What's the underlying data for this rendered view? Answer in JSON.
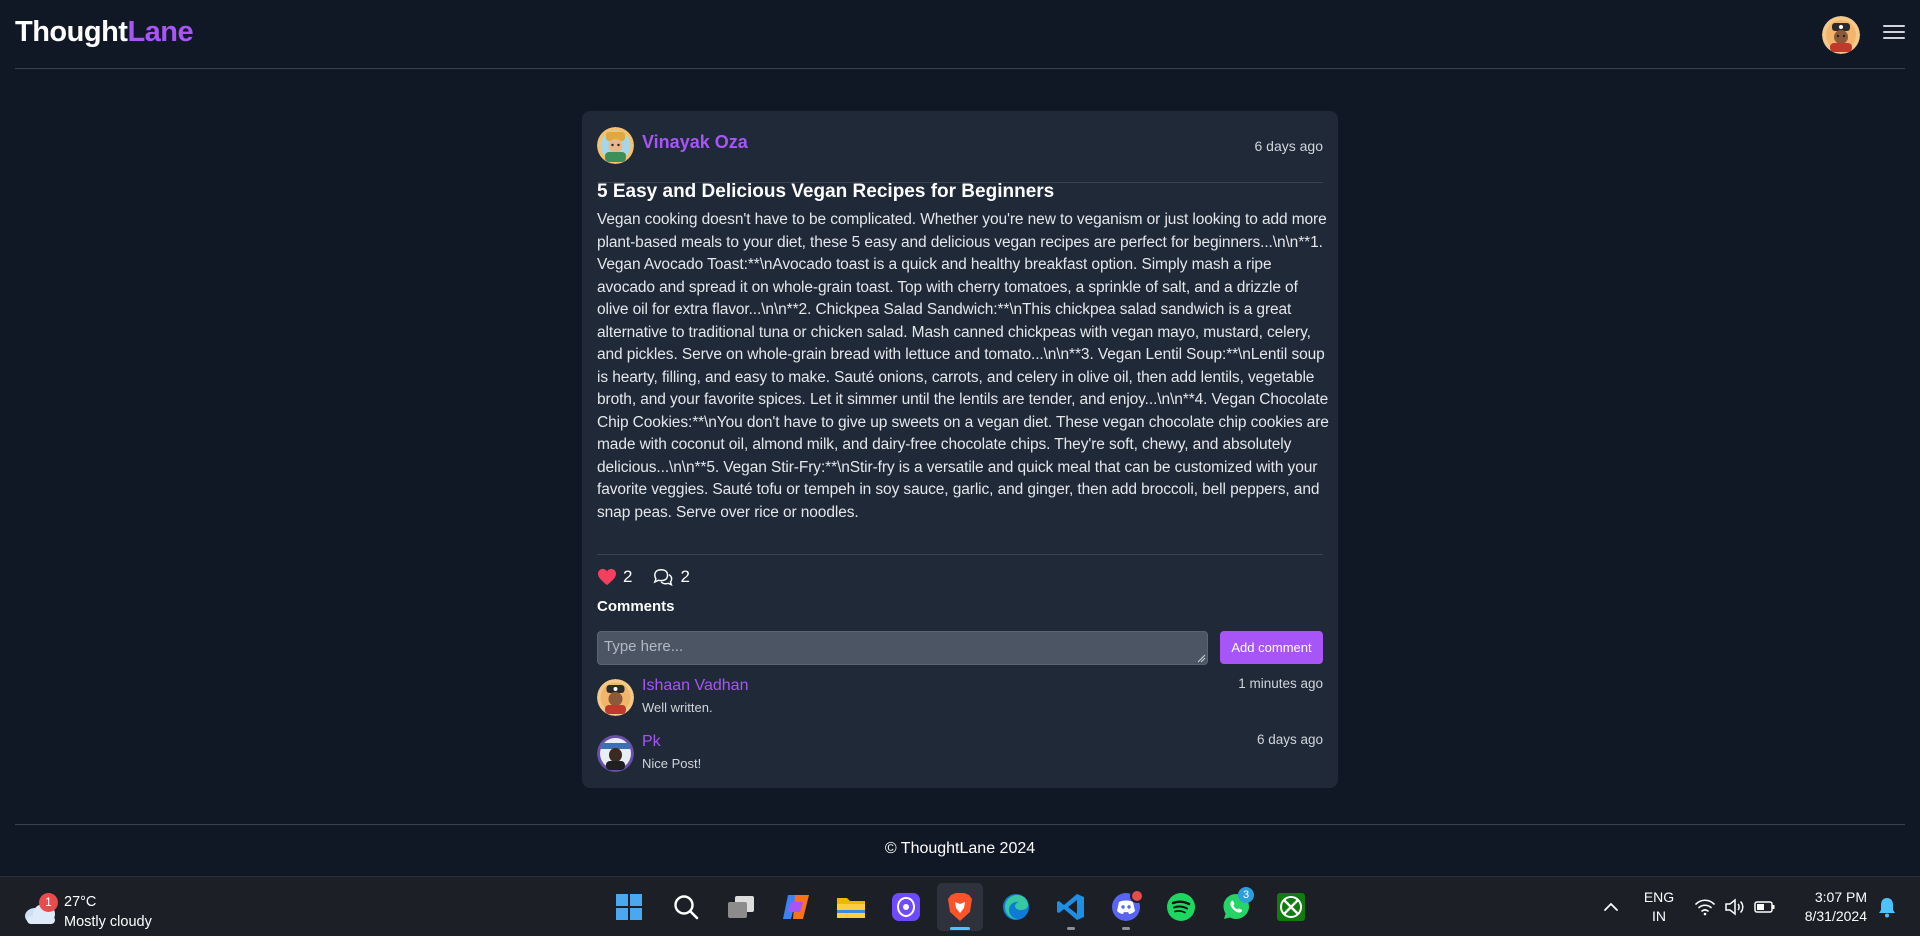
{
  "header": {
    "logo_part1": "Thought",
    "logo_part2": "Lane"
  },
  "post": {
    "author": "Vinayak Oza",
    "time": "6 days ago",
    "title": "5 Easy and Delicious Vegan Recipes for Beginners",
    "body": "Vegan cooking doesn't have to be complicated. Whether you're new to veganism or just looking to add more plant-based meals to your diet, these 5 easy and delicious vegan recipes are perfect for beginners...\\n\\n**1. Vegan Avocado Toast:**\\nAvocado toast is a quick and healthy breakfast option. Simply mash a ripe avocado and spread it on whole-grain toast. Top with cherry tomatoes, a sprinkle of salt, and a drizzle of olive oil for extra flavor...\\n\\n**2. Chickpea Salad Sandwich:**\\nThis chickpea salad sandwich is a great alternative to traditional tuna or chicken salad. Mash canned chickpeas with vegan mayo, mustard, celery, and pickles. Serve on whole-grain bread with lettuce and tomato...\\n\\n**3. Vegan Lentil Soup:**\\nLentil soup is hearty, filling, and easy to make. Sauté onions, carrots, and celery in olive oil, then add lentils, vegetable broth, and your favorite spices. Let it simmer until the lentils are tender, and enjoy...\\n\\n**4. Vegan Chocolate Chip Cookies:**\\nYou don't have to give up sweets on a vegan diet. These vegan chocolate chip cookies are made with coconut oil, almond milk, and dairy-free chocolate chips. They're soft, chewy, and absolutely delicious...\\n\\n**5. Vegan Stir-Fry:**\\nStir-fry is a versatile and quick meal that can be customized with your favorite veggies. Sauté tofu or tempeh in soy sauce, garlic, and ginger, then add broccoli, bell peppers, and snap peas. Serve over rice or noodles.",
    "likes": "2",
    "comments_count": "2"
  },
  "comments_section": {
    "heading": "Comments",
    "placeholder": "Type here...",
    "add_label": "Add comment",
    "items": [
      {
        "name": "Ishaan Vadhan",
        "text": "Well written.",
        "time": "1 minutes ago"
      },
      {
        "name": "Pk",
        "text": "Nice Post!",
        "time": "6 days ago"
      }
    ]
  },
  "footer": {
    "text": "© ThoughtLane 2024"
  },
  "taskbar": {
    "weather_temp": "27°C",
    "weather_cond": "Mostly cloudy",
    "weather_badge": "1",
    "whatsapp_badge": "3",
    "lang_line1": "ENG",
    "lang_line2": "IN",
    "time": "3:07 PM",
    "date": "8/31/2024",
    "apps": [
      "start-icon",
      "search-icon",
      "task-view-icon",
      "copilot-icon",
      "file-explorer-icon",
      "proton-vpn-icon",
      "brave-browser-icon",
      "edge-browser-icon",
      "vscode-icon",
      "discord-icon",
      "spotify-icon",
      "whatsapp-icon",
      "xbox-icon"
    ]
  },
  "colors": {
    "background": "#101725",
    "card": "#1f2937",
    "accent": "#a855f7",
    "like": "#f43f5e"
  }
}
